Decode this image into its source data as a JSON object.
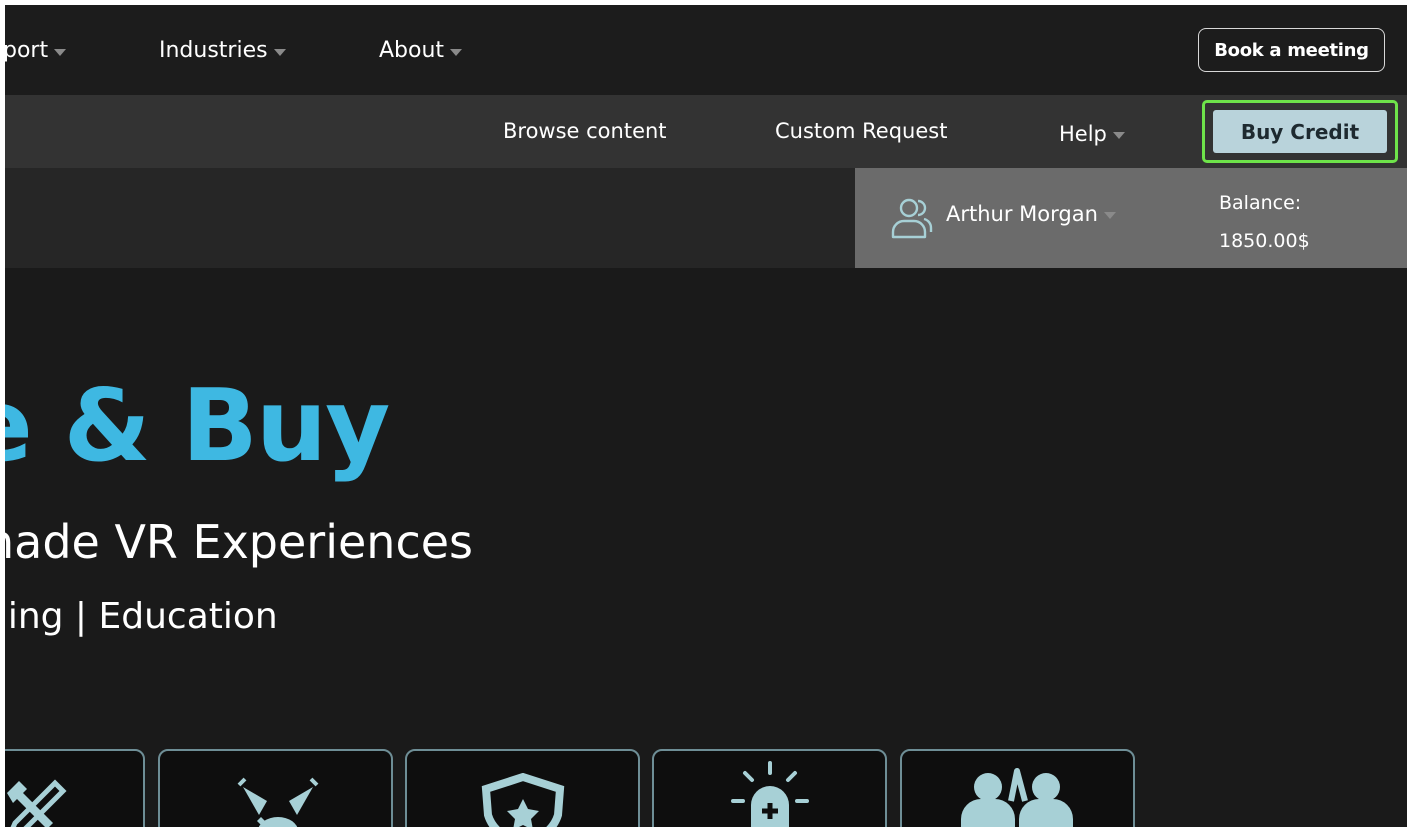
{
  "topnav": {
    "items": [
      {
        "label": "port"
      },
      {
        "label": "Industries"
      },
      {
        "label": "About"
      }
    ],
    "book_meeting_label": "Book a meeting"
  },
  "subnav": {
    "browse_label": "Browse content",
    "custom_label": "Custom Request",
    "help_label": "Help",
    "buy_credit_label": "Buy Credit"
  },
  "user": {
    "name": "Arthur Morgan",
    "balance_label": "Balance:",
    "balance_value": "1850.00$"
  },
  "hero": {
    "title": "e & Buy",
    "subtitle": "nade VR Experiences",
    "tagline": "ning | Education"
  },
  "categories": [
    {
      "icon": "tools-icon"
    },
    {
      "icon": "cleaning-icon"
    },
    {
      "icon": "shield-star-icon"
    },
    {
      "icon": "alarm-light-icon"
    },
    {
      "icon": "team-icon"
    }
  ],
  "colors": {
    "accent_blue": "#3eb8e2",
    "buy_button_bg": "#b9d3db",
    "highlight_green": "#6ee34a",
    "icon_teal": "#a7d0d6"
  }
}
